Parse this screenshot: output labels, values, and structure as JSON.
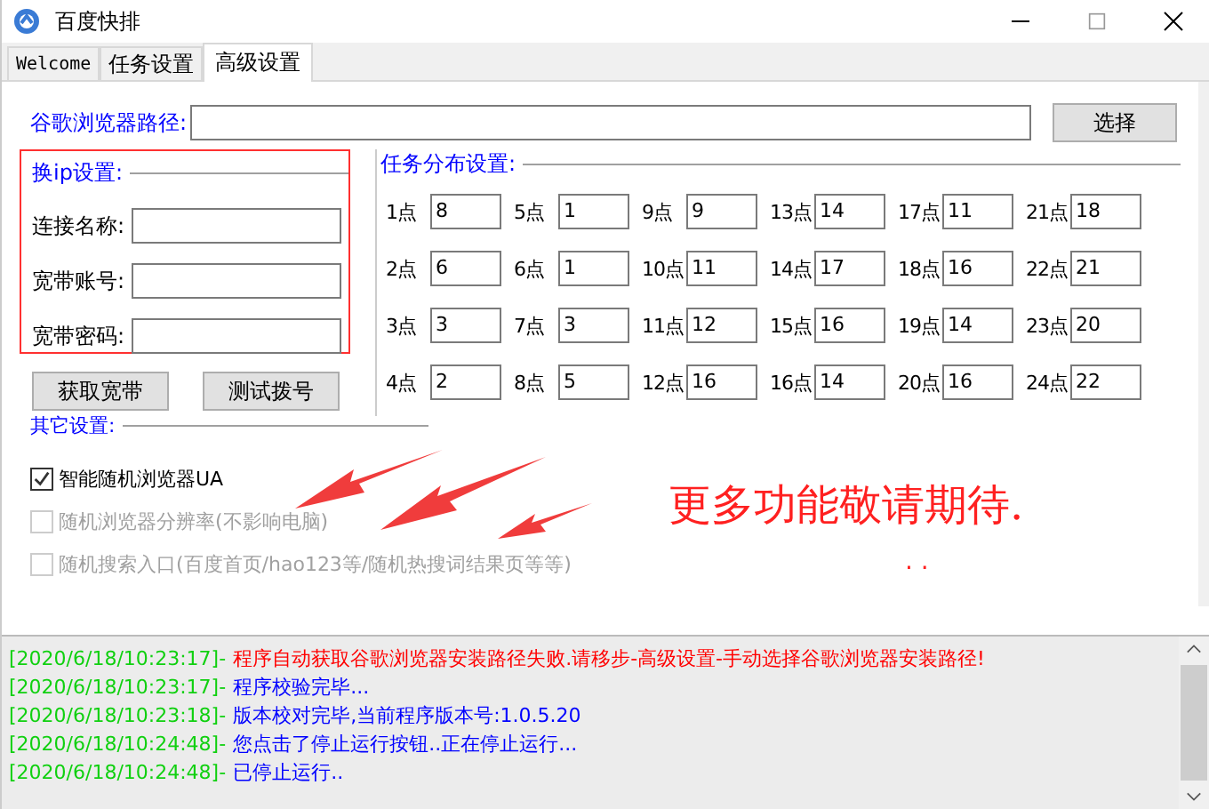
{
  "window": {
    "title": "百度快排"
  },
  "tabs": [
    {
      "label": "Welcome",
      "selected": false
    },
    {
      "label": "任务设置",
      "selected": false
    },
    {
      "label": "高级设置",
      "selected": true
    }
  ],
  "browser_path": {
    "label": "谷歌浏览器路径:",
    "button": "选择"
  },
  "ip_settings": {
    "title": "换ip设置:",
    "fields": [
      {
        "label": "连接名称:"
      },
      {
        "label": "宽带账号:"
      },
      {
        "label": "宽带密码:"
      }
    ],
    "buttons": [
      "获取宽带",
      "测试拨号"
    ]
  },
  "task_distribution": {
    "title": "任务分布设置:",
    "hours": [
      {
        "label": "1点",
        "value": "8"
      },
      {
        "label": "2点",
        "value": "6"
      },
      {
        "label": "3点",
        "value": "3"
      },
      {
        "label": "4点",
        "value": "2"
      },
      {
        "label": "5点",
        "value": "1"
      },
      {
        "label": "6点",
        "value": "1"
      },
      {
        "label": "7点",
        "value": "3"
      },
      {
        "label": "8点",
        "value": "5"
      },
      {
        "label": "9点",
        "value": "9"
      },
      {
        "label": "10点",
        "value": "11"
      },
      {
        "label": "11点",
        "value": "12"
      },
      {
        "label": "12点",
        "value": "16"
      },
      {
        "label": "13点",
        "value": "14"
      },
      {
        "label": "14点",
        "value": "17"
      },
      {
        "label": "15点",
        "value": "16"
      },
      {
        "label": "16点",
        "value": "14"
      },
      {
        "label": "17点",
        "value": "11"
      },
      {
        "label": "18点",
        "value": "16"
      },
      {
        "label": "19点",
        "value": "14"
      },
      {
        "label": "20点",
        "value": "16"
      },
      {
        "label": "21点",
        "value": "18"
      },
      {
        "label": "22点",
        "value": "21"
      },
      {
        "label": "23点",
        "value": "20"
      },
      {
        "label": "24点",
        "value": "22"
      }
    ]
  },
  "other_settings": {
    "title": "其它设置:",
    "options": [
      {
        "label": "智能随机浏览器UA",
        "checked": true,
        "disabled": false
      },
      {
        "label": "随机浏览器分辨率(不影响电脑)",
        "checked": false,
        "disabled": true
      },
      {
        "label": "随机搜索入口(百度首页/hao123等/随机热搜词结果页等等)",
        "checked": false,
        "disabled": true
      }
    ]
  },
  "annotation": {
    "text": "更多功能敬请期待.",
    "dots": ". ."
  },
  "log": [
    {
      "time": "[2020/6/18/10:23:17]-",
      "message": "程序自动获取谷歌浏览器安装路径失败.请移步-高级设置-手动选择谷歌浏览器安装路径!",
      "kind": "error"
    },
    {
      "time": "[2020/6/18/10:23:17]-",
      "message": "程序校验完毕...",
      "kind": "info"
    },
    {
      "time": "[2020/6/18/10:23:18]-",
      "message": "版本校对完毕,当前程序版本号:1.0.5.20",
      "kind": "info"
    },
    {
      "time": "[2020/6/18/10:24:48]-",
      "message": "您点击了停止运行按钮..正在停止运行...",
      "kind": "info"
    },
    {
      "time": "[2020/6/18/10:24:48]-",
      "message": "已停止运行..",
      "kind": "info"
    }
  ]
}
